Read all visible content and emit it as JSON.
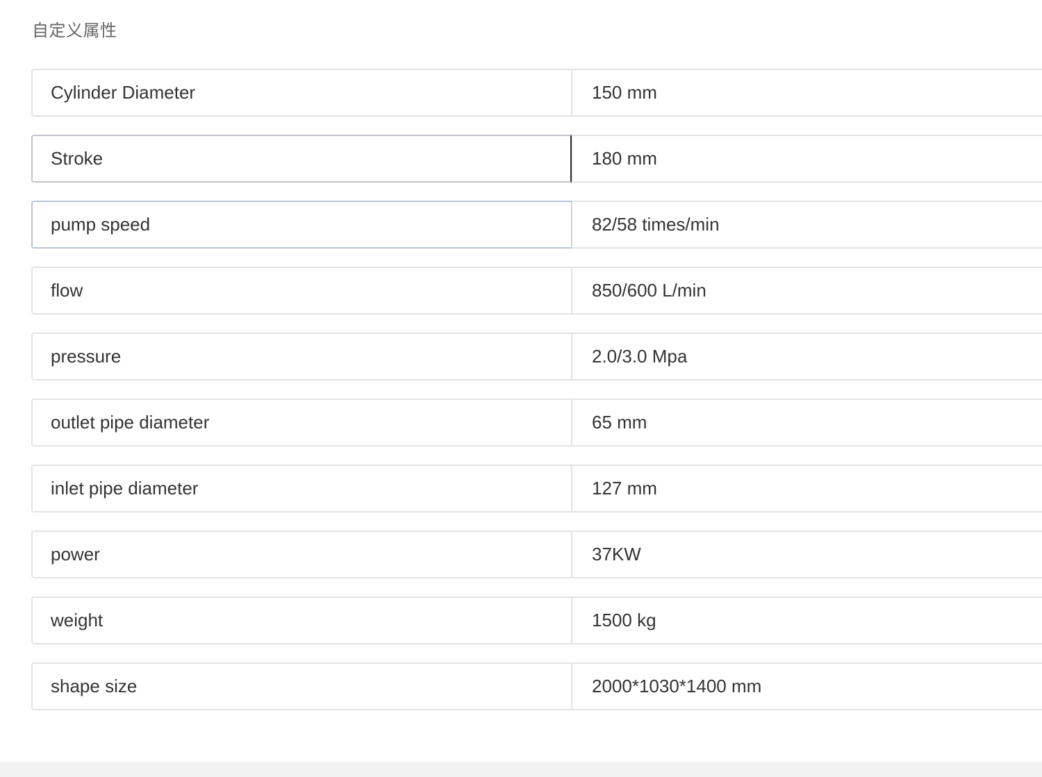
{
  "section": {
    "title": "自定义属性"
  },
  "attributes": [
    {
      "name": "Cylinder Diameter",
      "value": "150 mm"
    },
    {
      "name": "Stroke",
      "value": "180 mm"
    },
    {
      "name": "pump speed",
      "value": "82/58 times/min"
    },
    {
      "name": "flow",
      "value": "850/600 L/min"
    },
    {
      "name": "pressure",
      "value": "2.0/3.0 Mpa"
    },
    {
      "name": "outlet pipe diameter",
      "value": "65 mm"
    },
    {
      "name": "inlet pipe diameter",
      "value": "127 mm"
    },
    {
      "name": "power",
      "value": "37KW"
    },
    {
      "name": "weight",
      "value": "1500 kg"
    },
    {
      "name": "shape size",
      "value": "2000*1030*1400 mm"
    }
  ],
  "colors": {
    "border": "#e3e3e3",
    "text": "#333333",
    "title": "#666666"
  }
}
